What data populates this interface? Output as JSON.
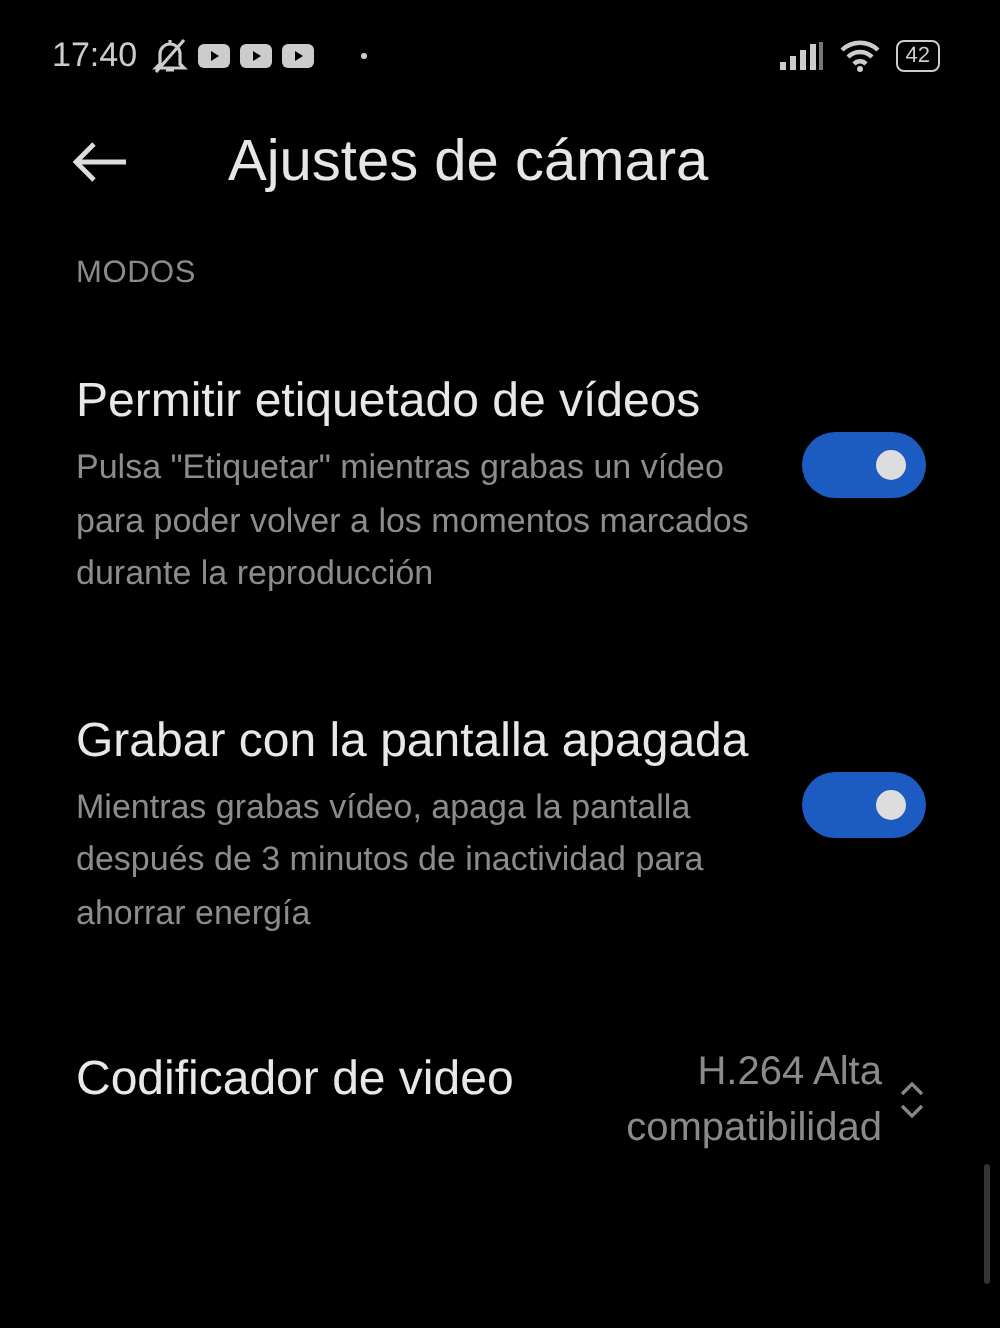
{
  "status_bar": {
    "time": "17:40",
    "battery": "42"
  },
  "header": {
    "title": "Ajustes de cámara"
  },
  "sections": [
    {
      "heading": "MODOS",
      "items": [
        {
          "kind": "toggle",
          "title": "Permitir etiquetado de vídeos",
          "description": "Pulsa \"Etiquetar\" mientras grabas un vídeo para poder volver a los momentos marcados durante la reproducción",
          "on": true
        },
        {
          "kind": "toggle",
          "title": "Grabar con la pantalla apagada",
          "description": "Mientras grabas vídeo, apaga la pantalla después de 3 minutos de inactividad para ahorrar energía",
          "on": true
        },
        {
          "kind": "select",
          "title": "Codificador de video",
          "value": "H.264 Alta compatibilidad"
        }
      ]
    }
  ]
}
